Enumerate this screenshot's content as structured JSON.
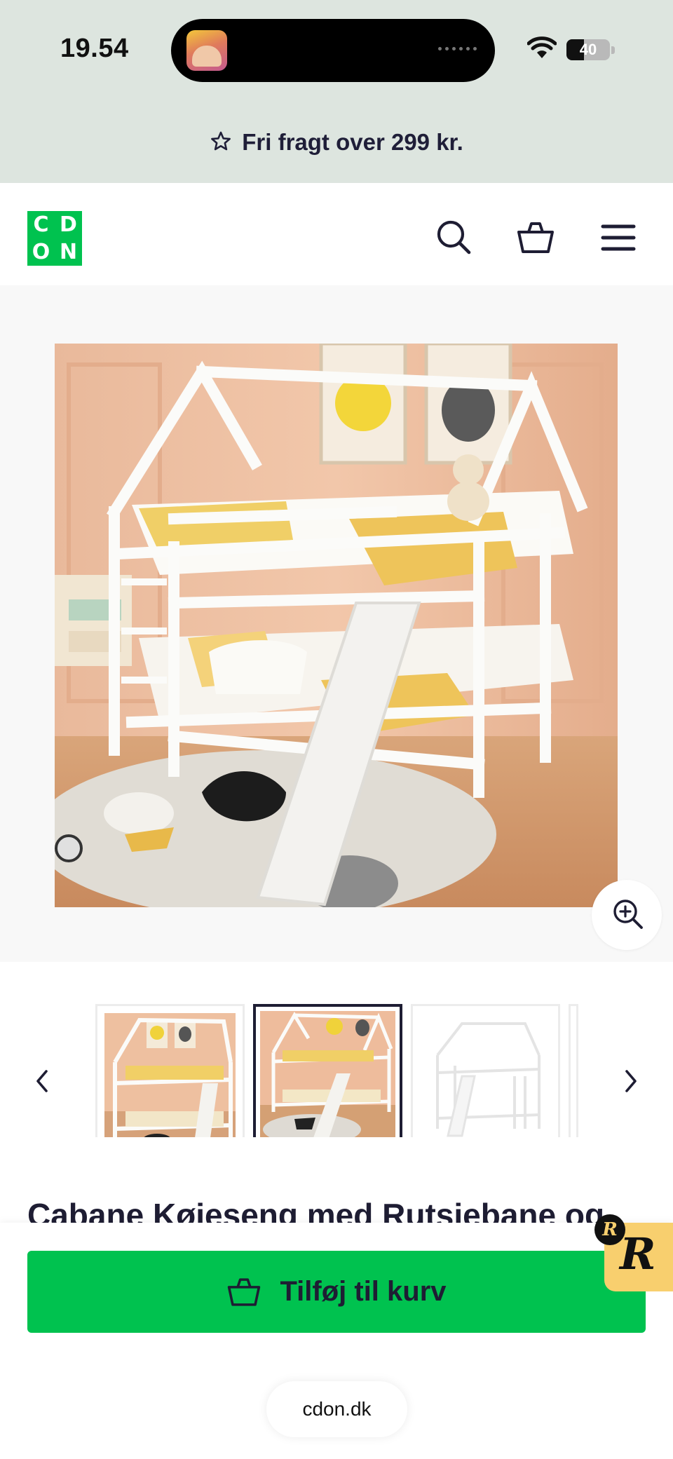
{
  "status_bar": {
    "time": "19.54",
    "battery_level": 40,
    "battery_label": "40"
  },
  "promo": {
    "text": "Fri fragt over 299 kr.",
    "icon": "star-icon"
  },
  "header": {
    "logo_letters": [
      "C",
      "D",
      "O",
      "N"
    ],
    "icons": [
      "search-icon",
      "basket-icon",
      "menu-icon"
    ]
  },
  "gallery": {
    "selected_index": 1,
    "prev_label": "‹",
    "next_label": "›",
    "zoom_icon": "zoom-in-icon"
  },
  "product": {
    "title": "Cabane Køjeseng med Rutsjebane og"
  },
  "cart": {
    "add_to_cart_label": "Tilføj til kurv",
    "icon": "basket-icon"
  },
  "browser": {
    "url": "cdon.dk"
  },
  "colors": {
    "brand_green": "#00c24f",
    "ink": "#1e1d33",
    "promo_bg": "#dde5df"
  }
}
